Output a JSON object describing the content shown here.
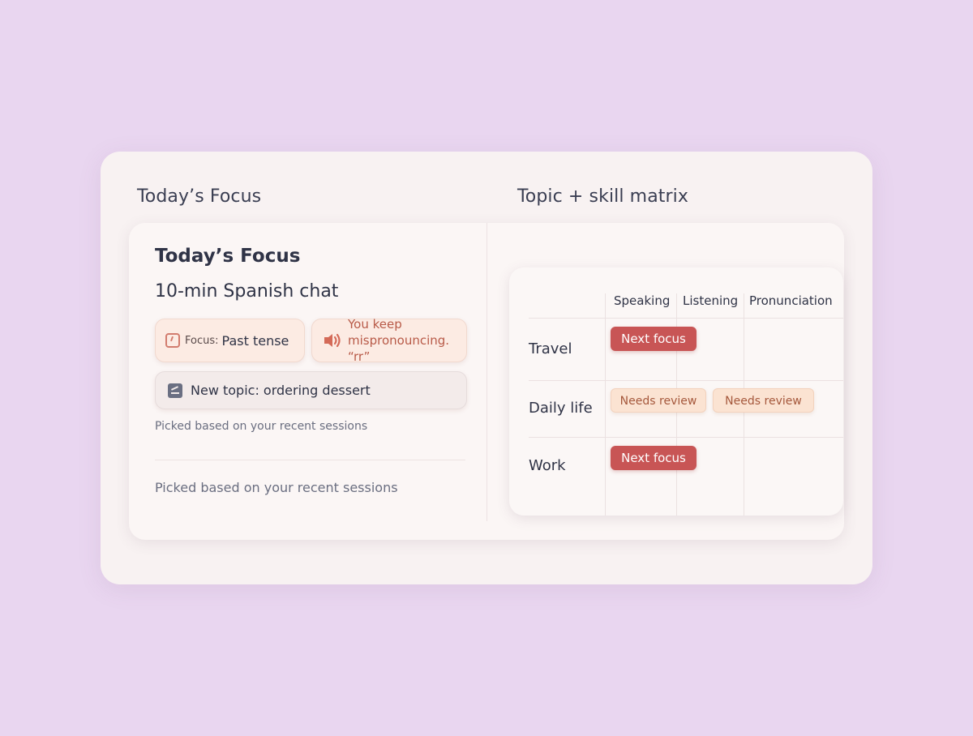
{
  "left_section": {
    "heading": "Today’s Focus",
    "card_title": "Today’s Focus",
    "card_subtitle": "10-min Spanish chat",
    "focus_chip": {
      "label": "Focus:",
      "value": "Past tense",
      "icon": "clock-icon"
    },
    "mispronounce_chip": {
      "line1": "You keep",
      "line2": "mispronouncing. “rr”",
      "icon": "speaker-icon"
    },
    "topic_chip": {
      "text": "New topic: ordering dessert",
      "icon": "edit-icon"
    },
    "picked_note_small": "Picked based on your recent sessions",
    "picked_note_large": "Picked based on your recent sessions"
  },
  "right_section": {
    "heading": "Topic + skill matrix",
    "columns": [
      "Speaking",
      "Listening",
      "Pronunciation"
    ],
    "rows": [
      {
        "label": "Travel",
        "badges": [
          {
            "text": "Next focus",
            "kind": "next"
          }
        ]
      },
      {
        "label": "Daily life",
        "badges": [
          {
            "text": "Needs review",
            "kind": "review"
          },
          {
            "text": "Needs review",
            "kind": "review"
          }
        ]
      },
      {
        "label": "Work",
        "badges": [
          {
            "text": "Next focus",
            "kind": "next"
          }
        ]
      }
    ]
  },
  "colors": {
    "background": "#e9d6f0",
    "next_focus": "#c85555",
    "needs_review_bg": "#fbe3d2",
    "needs_review_text": "#a5583c",
    "mispronounce_text": "#b85a48"
  }
}
